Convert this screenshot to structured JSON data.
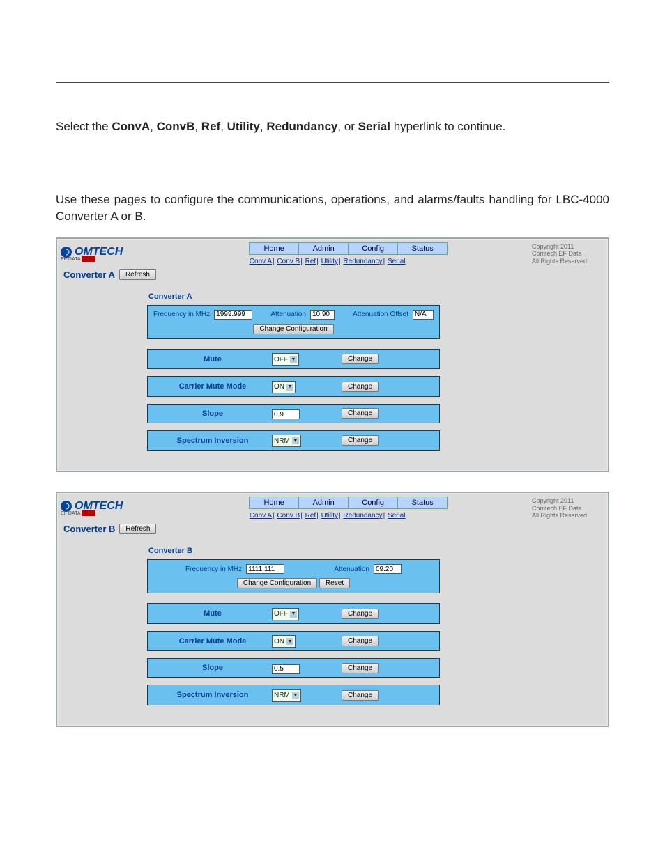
{
  "doc": {
    "intro_prefix": "Select the ",
    "link_convA": "ConvA",
    "link_convB": "ConvB",
    "link_ref": "Ref",
    "link_utility": "Utility",
    "link_redundancy": "Redundancy",
    "link_serial": "Serial",
    "intro_suffix": " hyperlink to continue.",
    "p2": "Use these pages to configure the communications, operations, and alarms/faults handling for LBC-4000 Converter A or B.",
    "sep": ", ",
    "or": ", or "
  },
  "common": {
    "logo_main": "OMTECH",
    "logo_sub1": "EF DATA ",
    "logo_sub2": "████",
    "copyright_l1": "Copyright 2011",
    "copyright_l2": "Comtech EF Data",
    "copyright_l3": "All Rights Reserved",
    "refresh": "Refresh",
    "change_cfg": "Change Configuration",
    "reset": "Reset",
    "change": "Change",
    "tabs": {
      "home": "Home",
      "admin": "Admin",
      "config": "Config",
      "status": "Status"
    },
    "sub": {
      "convA": "Conv A",
      "convB": "Conv B",
      "ref": "Ref",
      "utility": "Utility",
      "redundancy": "Redundancy",
      "serial": "Serial",
      "pipe": "|"
    },
    "labels": {
      "freq": "Frequency in MHz",
      "atten": "Attenuation",
      "atten_off": "Attenuation Offset",
      "mute": "Mute",
      "carrier": "Carrier Mute Mode",
      "slope": "Slope",
      "spec": "Spectrum Inversion"
    },
    "opts": {
      "off": "OFF",
      "on": "ON",
      "nrm": "NRM"
    }
  },
  "shotA": {
    "title": "Converter A",
    "panel_title": "Converter A",
    "freq": "1999.999",
    "atten": "10.90",
    "atten_off": "N/A",
    "mute": "OFF",
    "carrier": "ON",
    "slope": "0.9",
    "spec": "NRM"
  },
  "shotB": {
    "title": "Converter B",
    "panel_title": "Converter B",
    "freq": "1111.111",
    "atten": "09.20",
    "mute": "OFF",
    "carrier": "ON",
    "slope": "0.5",
    "spec": "NRM"
  }
}
